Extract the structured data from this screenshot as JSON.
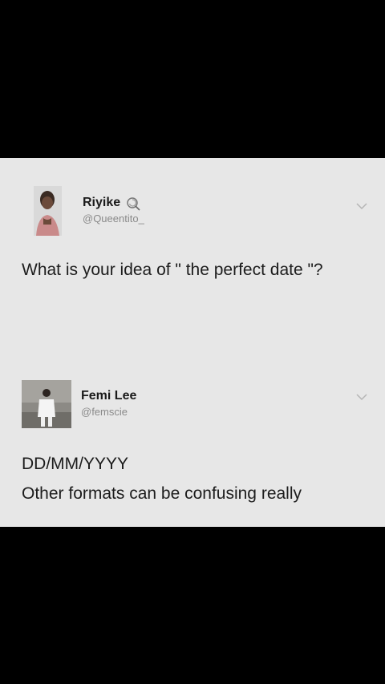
{
  "tweets": [
    {
      "display_name": "Riyike",
      "handle": "@Queentito_",
      "text": "What is your idea of \" the perfect date \"?",
      "avatar_icon": "profile-photo",
      "badge_icon": "lollipop-emoji-icon",
      "menu_icon": "chevron-down-icon"
    },
    {
      "display_name": "Femi Lee",
      "handle": "@femscie",
      "text_line_1": "DD/MM/YYYY",
      "text_line_2": "Other formats can be confusing really",
      "avatar_icon": "profile-photo",
      "menu_icon": "chevron-down-icon"
    }
  ],
  "colors": {
    "background": "#000000",
    "card": "#e7e7e7",
    "text": "#1c1c1c",
    "handle": "#8a8a8a"
  }
}
